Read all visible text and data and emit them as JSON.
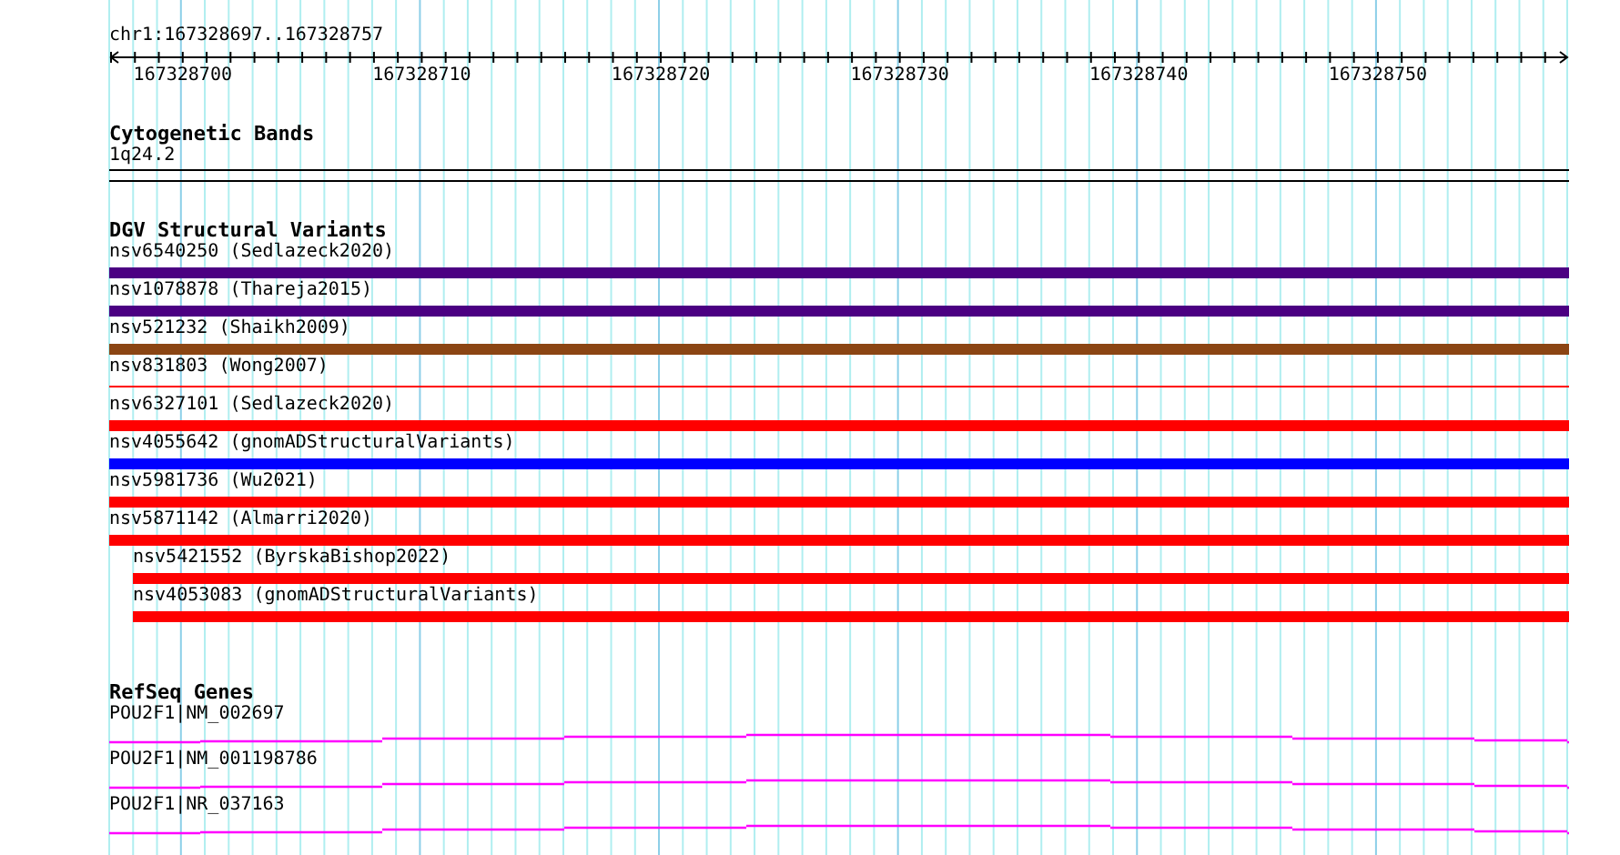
{
  "ruler": {
    "location": "chr1:167328697..167328757",
    "ticks": [
      "167328700",
      "167328710",
      "167328720",
      "167328730",
      "167328740",
      "167328750"
    ]
  },
  "cytogenetic_bands": {
    "title": "Cytogenetic Bands",
    "band": "1q24.2"
  },
  "dgv_structural_variants": {
    "title": "DGV Structural Variants",
    "features": [
      {
        "label": "nsv6540250 (Sedlazeck2020)",
        "kind": "bar",
        "color": "#4b0082",
        "clipped_left": true
      },
      {
        "label": "nsv1078878 (Thareja2015)",
        "kind": "bar",
        "color": "#4b0082",
        "clipped_left": true
      },
      {
        "label": "nsv521232 (Shaikh2009)",
        "kind": "bar",
        "color": "#8b4513",
        "clipped_left": true
      },
      {
        "label": "nsv831803 (Wong2007)",
        "kind": "line",
        "color": "#ff0000",
        "clipped_left": true
      },
      {
        "label": "nsv6327101 (Sedlazeck2020)",
        "kind": "bar",
        "color": "#ff0000",
        "clipped_left": true
      },
      {
        "label": "nsv4055642 (gnomADStructuralVariants)",
        "kind": "bar",
        "color": "#0000ff",
        "clipped_left": true
      },
      {
        "label": "nsv5981736 (Wu2021)",
        "kind": "bar",
        "color": "#ff0000",
        "clipped_left": true
      },
      {
        "label": "nsv5871142 (Almarri2020)",
        "kind": "bar",
        "color": "#ff0000",
        "clipped_left": true
      },
      {
        "label": "nsv5421552 (ByrskaBishop2022)",
        "kind": "bar",
        "color": "#ff0000",
        "clipped_left": false
      },
      {
        "label": "nsv4053083 (gnomADStructuralVariants)",
        "kind": "bar",
        "color": "#ff0000",
        "clipped_left": false
      }
    ]
  },
  "refseq_genes": {
    "title": "RefSeq Genes",
    "transcripts": [
      {
        "label": "POU2F1|NM_002697"
      },
      {
        "label": "POU2F1|NM_001198786"
      },
      {
        "label": "POU2F1|NR_037163"
      }
    ]
  }
}
